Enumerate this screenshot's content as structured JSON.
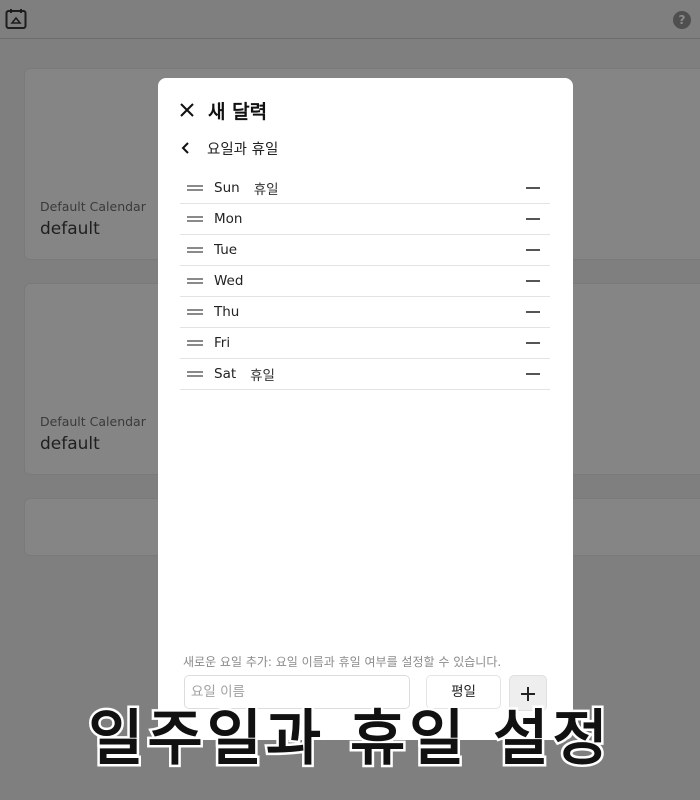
{
  "background": {
    "cards": [
      {
        "label": "Default Calendar",
        "value": "default"
      },
      {
        "label": "Default Calendar",
        "value": "default"
      }
    ]
  },
  "modal": {
    "title": "새 달력",
    "section_title": "요일과 휴일",
    "days": [
      {
        "name": "Sun",
        "tag": "휴일"
      },
      {
        "name": "Mon",
        "tag": ""
      },
      {
        "name": "Tue",
        "tag": ""
      },
      {
        "name": "Wed",
        "tag": ""
      },
      {
        "name": "Thu",
        "tag": ""
      },
      {
        "name": "Fri",
        "tag": ""
      },
      {
        "name": "Sat",
        "tag": "휴일"
      }
    ],
    "hint": "새로운 요일 추가: 요일 이름과 휴일 여부를 설정할 수 있습니다.",
    "name_input": {
      "value": "",
      "placeholder": "요일 이름"
    },
    "type_button_label": "평일"
  },
  "caption": "일주일과 휴일 설정",
  "icons": {
    "app": "calendar-app-icon",
    "help": "help-icon",
    "close": "close-icon",
    "back": "back-chevron-icon",
    "drag": "drag-handle-icon",
    "remove": "remove-icon",
    "add": "plus-icon"
  }
}
